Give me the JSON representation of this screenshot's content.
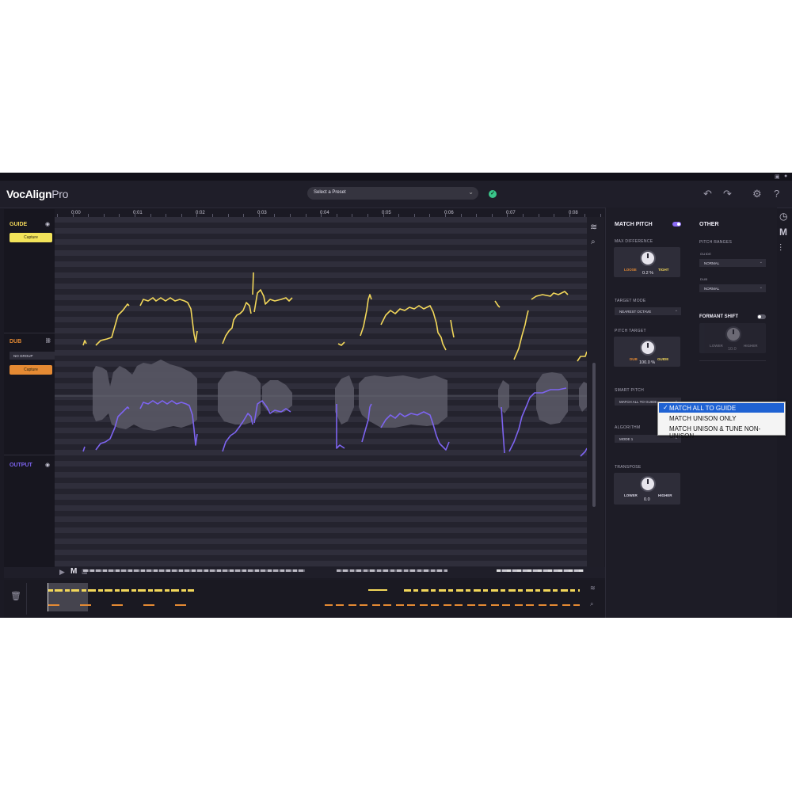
{
  "app": {
    "name_main": "VocAlign",
    "name_sub": "Pro"
  },
  "header": {
    "preset_placeholder": "Select a Preset",
    "status": "✓",
    "undo_icon": "undo-icon",
    "redo_icon": "redo-icon",
    "settings_icon": "gear-icon",
    "help_icon": "?"
  },
  "timeline": {
    "ticks": [
      "0:00",
      "0:01",
      "0:02",
      "0:03",
      "0:04",
      "0:05",
      "0:06",
      "0:07",
      "0:08"
    ]
  },
  "tracks": {
    "guide": {
      "label": "GUIDE",
      "capture": "Capture",
      "color": "#f2d75a"
    },
    "dub": {
      "label": "DUB",
      "group": "NO GROUP",
      "capture": "Capture",
      "color": "#e58a33"
    },
    "output": {
      "label": "OUTPUT",
      "color": "#7d64f0"
    }
  },
  "panel": {
    "match_pitch": {
      "title": "MATCH PITCH",
      "enabled": true,
      "max_difference": {
        "label": "MAX DIFFERENCE",
        "left": "LOOSE",
        "right": "TIGHT",
        "value": "0.2 %"
      },
      "target_mode": {
        "label": "TARGET MODE",
        "value": "NEAREST OCTAVE"
      },
      "pitch_target": {
        "label": "PITCH TARGET",
        "left": "DUB",
        "right": "GUIDE",
        "value": "100.0 %"
      },
      "smart_pitch": {
        "label": "SMART PITCH",
        "value": "MATCH ALL TO GUIDE"
      },
      "algorithm": {
        "label": "ALGORITHM",
        "value": "MODE 1"
      },
      "transpose": {
        "label": "TRANSPOSE",
        "left": "LOWER",
        "right": "HIGHER",
        "value": "0.0"
      }
    },
    "other": {
      "title": "OTHER",
      "pitch_ranges": {
        "label": "PITCH RANGES",
        "guide_label": "GUIDE",
        "guide_value": "NORMAL",
        "dub_label": "DUB",
        "dub_value": "NORMAL"
      },
      "formant_shift": {
        "title": "FORMANT SHIFT",
        "enabled": false,
        "left": "LOWER",
        "right": "HIGHER",
        "value": "10.0"
      }
    }
  },
  "dropdown": {
    "options": [
      "MATCH ALL TO GUIDE",
      "MATCH UNISON ONLY",
      "MATCH UNISON & TUNE NON-UNISON"
    ],
    "selected": "MATCH ALL TO GUIDE"
  },
  "colors": {
    "guide": "#f2d75a",
    "dub": "#e58a33",
    "output": "#7d64f0",
    "accent": "#8b6cf6",
    "background": "#1b1a24"
  }
}
